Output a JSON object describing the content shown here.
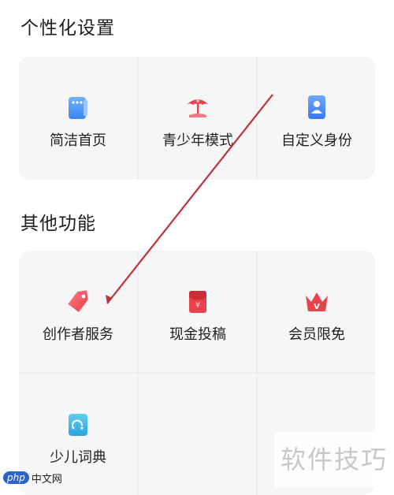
{
  "sections": {
    "personalization": {
      "title": "个性化设置",
      "items": [
        {
          "label": "简洁首页",
          "icon": "simple-home-icon"
        },
        {
          "label": "青少年模式",
          "icon": "umbrella-icon"
        },
        {
          "label": "自定义身份",
          "icon": "identity-card-icon"
        }
      ]
    },
    "other": {
      "title": "其他功能",
      "items": [
        {
          "label": "创作者服务",
          "icon": "tag-icon"
        },
        {
          "label": "现金投稿",
          "icon": "red-envelope-icon"
        },
        {
          "label": "会员限免",
          "icon": "crown-icon"
        },
        {
          "label": "少儿词典",
          "icon": "dictionary-icon"
        }
      ]
    }
  },
  "watermark": {
    "text": "软件技巧",
    "logo_php": "php",
    "logo_cn": "中文网"
  },
  "colors": {
    "accent_red": "#e8434b",
    "accent_blue": "#4b8ef0",
    "card_bg": "#f6f6f8",
    "arrow": "#c0313a"
  }
}
